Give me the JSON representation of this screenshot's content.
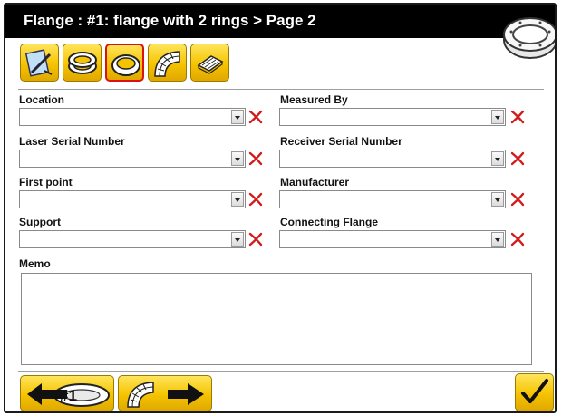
{
  "window": {
    "title": "Flange :  #1: flange with 2 rings > Page 2"
  },
  "toolbar": {
    "buttons": [
      {
        "icon": "measure-book-icon"
      },
      {
        "icon": "two-rings-icon"
      },
      {
        "icon": "single-ring-icon",
        "active": true
      },
      {
        "icon": "pipe-bend-icon"
      },
      {
        "icon": "report-sheet-icon"
      }
    ]
  },
  "form": {
    "location": {
      "label": "Location",
      "value": ""
    },
    "measured_by": {
      "label": "Measured By",
      "value": ""
    },
    "laser_serial": {
      "label": "Laser Serial Number",
      "value": ""
    },
    "receiver_serial": {
      "label": "Receiver Serial Number",
      "value": ""
    },
    "first_point": {
      "label": "First point",
      "value": ""
    },
    "manufacturer": {
      "label": "Manufacturer",
      "value": ""
    },
    "support": {
      "label": "Support",
      "value": ""
    },
    "connecting_flange": {
      "label": "Connecting Flange",
      "value": ""
    },
    "memo": {
      "label": "Memo",
      "value": ""
    }
  },
  "footer": {
    "back_badge": "#1",
    "confirm_icon": "checkmark-icon"
  },
  "colors": {
    "button_yellow": "#f5c300",
    "clear_red": "#d11a1a",
    "active_border": "#dd1111",
    "title_bg": "#000000"
  }
}
